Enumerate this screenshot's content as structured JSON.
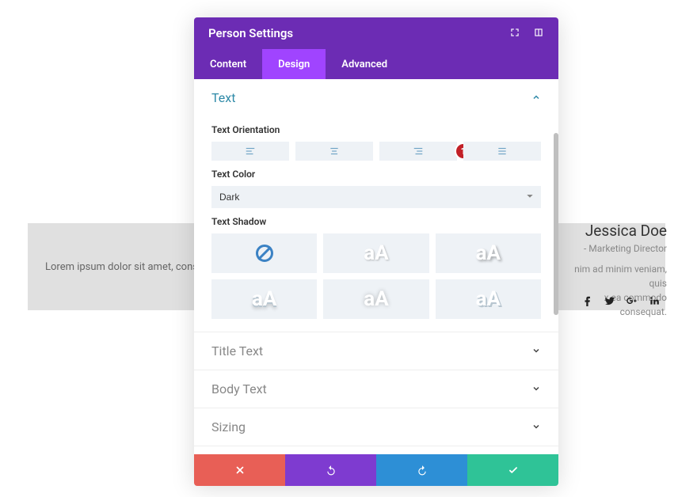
{
  "modal": {
    "title": "Person Settings",
    "tabs": [
      "Content",
      "Design",
      "Advanced"
    ],
    "active_tab_index": 1,
    "sections": {
      "text": {
        "title": "Text",
        "orientation_label": "Text Orientation",
        "color_label": "Text Color",
        "color_value": "Dark",
        "shadow_label": "Text Shadow",
        "marker": "1"
      },
      "collapsed": [
        {
          "title": "Title Text"
        },
        {
          "title": "Body Text"
        },
        {
          "title": "Sizing"
        }
      ]
    },
    "footer_icons": {
      "cancel": "close-icon",
      "undo": "undo-icon",
      "redo": "redo-icon",
      "confirm": "check-icon"
    }
  },
  "preview": {
    "lorem": "Lorem ipsum dolor sit amet, consecte",
    "name": "Jessica Doe",
    "role": "- Marketing Director",
    "body1": "nim ad minim veniam, quis",
    "body2": "x ea commodo consequat."
  }
}
